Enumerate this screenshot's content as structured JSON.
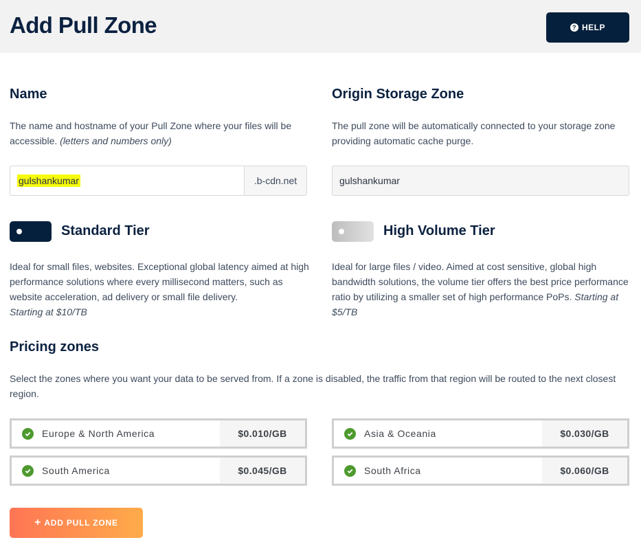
{
  "header": {
    "title": "Add Pull Zone",
    "help_icon": "question-circle-icon",
    "help_label": "HELP"
  },
  "name_section": {
    "title": "Name",
    "description": "The name and hostname of your Pull Zone where your files will be accessible.",
    "description_note": "(letters and numbers only)",
    "input_value": "gulshankumar",
    "suffix": ".b-cdn.net"
  },
  "origin_section": {
    "title": "Origin Storage Zone",
    "description": "The pull zone will be automatically connected to your storage zone providing automatic cache purge.",
    "input_value": "gulshankumar"
  },
  "tiers": [
    {
      "title": "Standard Tier",
      "selected": true,
      "description": "Ideal for small files, websites. Exceptional global latency aimed at high performance solutions where every millisecond matters, such as website acceleration, ad delivery or small file delivery.",
      "price_note": "Starting at $10/TB"
    },
    {
      "title": "High Volume Tier",
      "selected": false,
      "description": "Ideal for large files / video. Aimed at cost sensitive, global high bandwidth solutions, the volume tier offers the best price performance ratio by utilizing a smaller set of high performance PoPs.",
      "price_note": "Starting at $5/TB"
    }
  ],
  "pricing": {
    "title": "Pricing zones",
    "description": "Select the zones where you want your data to be served from. If a zone is disabled, the traffic from that region will be routed to the next closest region.",
    "zones": [
      {
        "name": "Europe & North America",
        "price": "$0.010/GB",
        "enabled": true,
        "icon": "check-circle-icon"
      },
      {
        "name": "Asia & Oceania",
        "price": "$0.030/GB",
        "enabled": true,
        "icon": "check-circle-icon"
      },
      {
        "name": "South America",
        "price": "$0.045/GB",
        "enabled": true,
        "icon": "check-circle-icon"
      },
      {
        "name": "South Africa",
        "price": "$0.060/GB",
        "enabled": true,
        "icon": "check-circle-icon"
      }
    ]
  },
  "submit": {
    "icon": "plus-icon",
    "label": "ADD PULL ZONE"
  },
  "colors": {
    "primary_navy": "#04203c",
    "check_green": "#4e9a2e",
    "highlight_yellow": "#f5fb0a",
    "button_gradient_start": "#ff7554",
    "button_gradient_end": "#ffac4a"
  }
}
